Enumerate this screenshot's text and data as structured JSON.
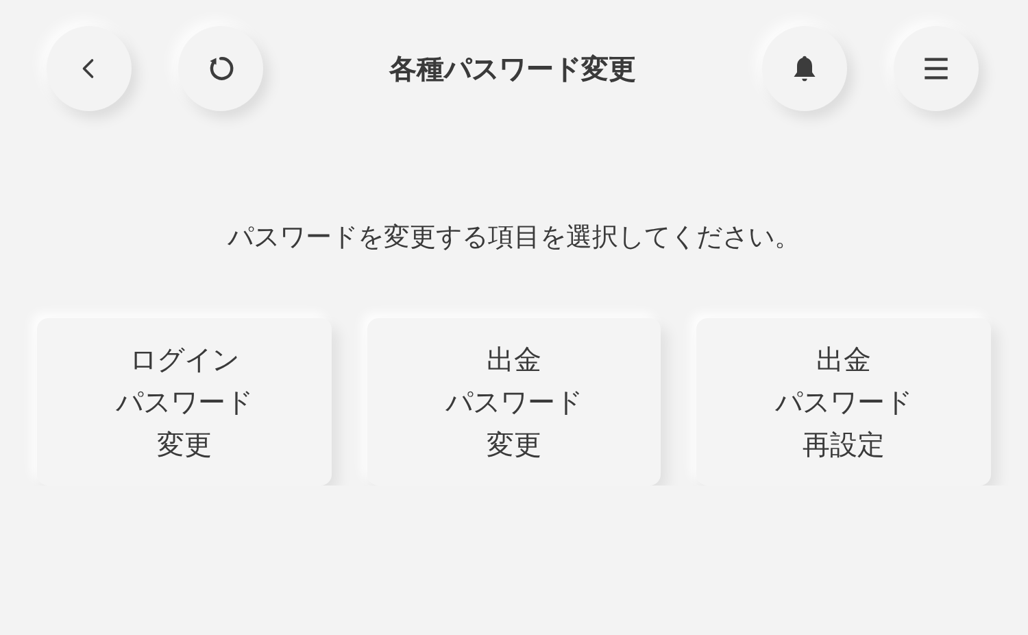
{
  "header": {
    "title": "各種パスワード変更"
  },
  "instruction": "パスワードを変更する項目を選択してください。",
  "options": [
    {
      "lines": [
        "ログイン",
        "パスワード",
        "変更"
      ]
    },
    {
      "lines": [
        "出金",
        "パスワード",
        "変更"
      ]
    },
    {
      "lines": [
        "出金",
        "パスワード",
        "再設定"
      ]
    }
  ]
}
